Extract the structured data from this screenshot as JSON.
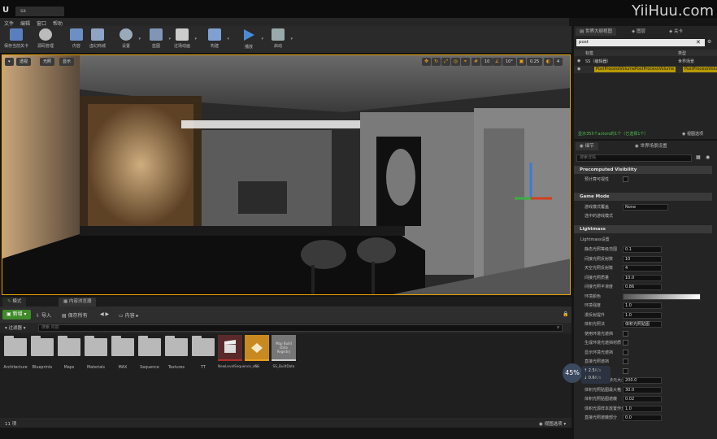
{
  "window": {
    "tab_title": "sa",
    "watermark": "YiiHuu.com"
  },
  "menu": [
    "文件",
    "编辑",
    "窗口",
    "帮助"
  ],
  "toolbar": [
    {
      "label": "保存当前关卡",
      "icon": "save-icon"
    },
    {
      "label": "源码管理",
      "icon": "source-control-icon"
    },
    {
      "label": "内容",
      "icon": "content-icon"
    },
    {
      "label": "虚幻商城",
      "icon": "marketplace-icon"
    },
    {
      "label": "设置",
      "icon": "settings-icon"
    },
    {
      "label": "蓝图",
      "icon": "blueprint-icon"
    },
    {
      "label": "过场动画",
      "icon": "cinematics-icon"
    },
    {
      "label": "构建",
      "icon": "build-icon"
    },
    {
      "label": "播放",
      "icon": "play-icon"
    },
    {
      "label": "启动",
      "icon": "launch-icon"
    }
  ],
  "viewport": {
    "buttons": [
      "透视",
      "光照",
      "显示"
    ],
    "snap_angle": "10°",
    "grid_value": "10",
    "camera_speed": "0.25",
    "screen_pct": "4"
  },
  "content_browser": {
    "tabs": [
      "模式",
      "内容浏览器"
    ],
    "add_label": "新增",
    "import_label": "导入",
    "save_all_label": "保存所有",
    "path_label": "内容",
    "filter_label": "过滤器",
    "search_placeholder": "搜索 内容",
    "folders": [
      "Architecture",
      "Blueprints",
      "Maps",
      "Materials",
      "MAX",
      "Sequence",
      "Textures",
      "TT"
    ],
    "assets": [
      {
        "name": "NewLevelSequence_xhu",
        "thumb": ""
      },
      {
        "name": "SS",
        "thumb": ""
      },
      {
        "name": "SS_BuiltData",
        "thumb": "Map Build Data Registry"
      }
    ],
    "item_count": "11 项",
    "view_options": "视图选项"
  },
  "outliner": {
    "tabs": [
      "世界大纲视图",
      "图层",
      "关卡"
    ],
    "search_value": "post",
    "col_label": "标签",
    "col_type": "类型",
    "rows": [
      {
        "label": "SS（编辑器）",
        "type": "世界场景"
      },
      {
        "label": "PostProcessVolumePostProcessVolume",
        "type": "PostProcessVolum"
      }
    ],
    "status": "显示355个actors的1个（已选择1个）",
    "view_options": "视图选项"
  },
  "details": {
    "tabs": [
      "细节",
      "世界场景设置"
    ],
    "search_placeholder": "搜索详情",
    "sections": {
      "precomputed": "Precomputed Visibility",
      "game_mode": "Game Mode",
      "lightmass": "Lightmass"
    },
    "precomputed_rows": [
      {
        "label": "预计算可视性"
      }
    ],
    "game_mode_rows": [
      {
        "label": "游戏模式覆盖",
        "value": "None"
      },
      {
        "label": "选中的游戏模式",
        "value": ""
      }
    ],
    "lightmass_title": "Lightmass设置",
    "lightmass_rows": [
      {
        "label": "静态光照等级范围",
        "value": "0.1"
      },
      {
        "label": "间接光照反射数",
        "value": "10"
      },
      {
        "label": "天空光照反射数",
        "value": "4"
      },
      {
        "label": "间接光照质量",
        "value": "10.0"
      },
      {
        "label": "间接光照平滑度",
        "value": "0.86"
      },
      {
        "label": "环境颜色",
        "value": ""
      },
      {
        "label": "环境强度",
        "value": "1.0"
      },
      {
        "label": "漫反射提升",
        "value": "1.0"
      },
      {
        "label": "体积光照法",
        "value": "体积光照贴图"
      },
      {
        "label": "使用环境光遮挡",
        "value": ""
      },
      {
        "label": "生成环境光遮挡材质",
        "value": ""
      },
      {
        "label": "显示环境光遮挡",
        "value": ""
      },
      {
        "label": "直接光照遮挡",
        "value": ""
      },
      {
        "label": "间接光照遮挡",
        "value": ""
      },
      {
        "label": "体积光照贴图单元大小",
        "value": "200.0"
      },
      {
        "label": "体积光照贴图最大格",
        "value": "30.0"
      },
      {
        "label": "体积光照贴图遮蔽",
        "value": "0.02"
      },
      {
        "label": "体积光源样本放置作为",
        "value": "1.0"
      },
      {
        "label": "直接光照遮蔽部分",
        "value": "0.0"
      }
    ]
  },
  "overlay": {
    "percent": "45%",
    "up": "2.5",
    "down": "0.6",
    "up_unit": "K/s",
    "down_unit": "K/s"
  }
}
